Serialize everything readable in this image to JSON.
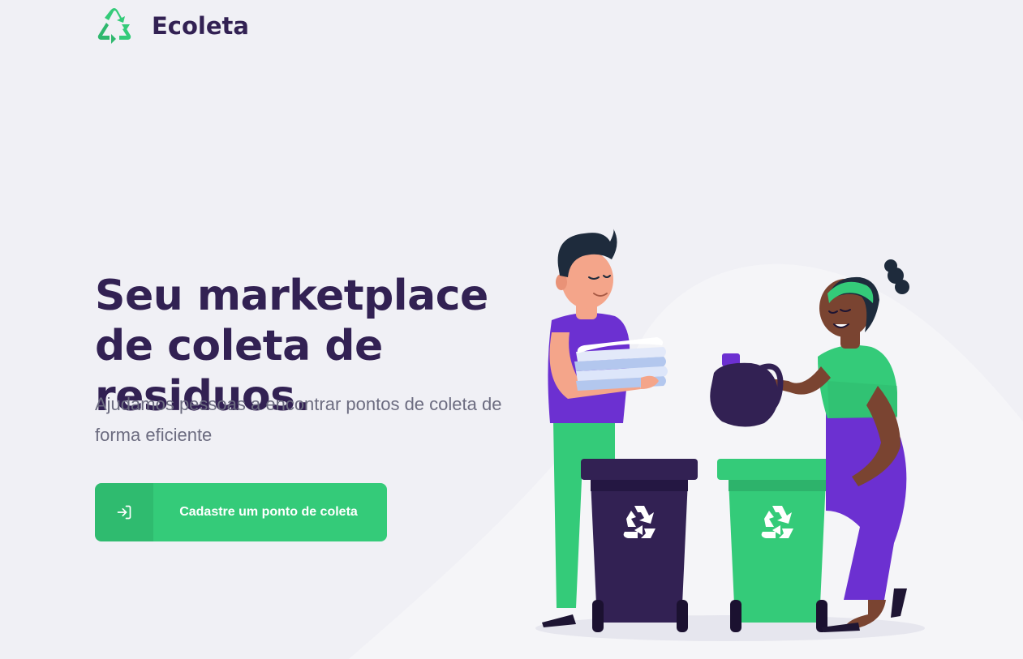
{
  "brand": {
    "name": "Ecoleta"
  },
  "hero": {
    "title": "Seu marketplace de coleta de residuos.",
    "subtitle": "Ajudamos pessoas a encontrar pontos de coleta de forma eficiente"
  },
  "cta": {
    "label": "Cadastre um ponto de coleta",
    "icon": "log-in-icon"
  },
  "icons": {
    "logo": "recycle-icon",
    "bin_symbol": "recycle-icon"
  },
  "colors": {
    "background": "#F0F0F5",
    "primary": "#34CB79",
    "title": "#322153",
    "text": "#6C6C80",
    "accent_purple": "#6C30D1"
  }
}
